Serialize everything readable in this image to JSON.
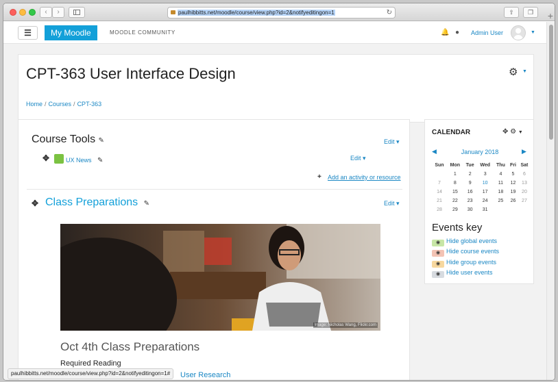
{
  "browser": {
    "url": "paulhibbitts.net/moodle/course/view.php?id=2&notifyeditingon=1",
    "status_url": "paulhibbitts.net/moodle/course/view.php?id=2&notifyeditingon=1#"
  },
  "navbar": {
    "brand": "My Moodle",
    "community": "MOODLE COMMUNITY",
    "user_name": "Admin User"
  },
  "header": {
    "title": "CPT-363 User Interface Design",
    "breadcrumb": [
      "Home",
      "Courses",
      "CPT-363"
    ]
  },
  "course_tools": {
    "title": "Course Tools",
    "edit_label": "Edit",
    "item_label": "UX News",
    "item_edit_label": "Edit",
    "add_activity": "Add an activity or resource"
  },
  "class_prep": {
    "title": "Class Preparations",
    "edit_label": "Edit",
    "image_caption": "Image: Nicholas Wang, Flickr.com",
    "heading": "Oct 4th Class Preparations",
    "required_reading": "Required Reading",
    "link_partial": "User Research"
  },
  "calendar": {
    "heading": "CALENDAR",
    "month": "January 2018",
    "weekdays": [
      "Sun",
      "Mon",
      "Tue",
      "Wed",
      "Thu",
      "Fri",
      "Sat"
    ],
    "weeks": [
      [
        "",
        "1",
        "2",
        "3",
        "4",
        "5",
        "6"
      ],
      [
        "7",
        "8",
        "9",
        "10",
        "11",
        "12",
        "13"
      ],
      [
        "14",
        "15",
        "16",
        "17",
        "18",
        "19",
        "20"
      ],
      [
        "21",
        "22",
        "23",
        "24",
        "25",
        "26",
        "27"
      ],
      [
        "28",
        "29",
        "30",
        "31",
        "",
        "",
        ""
      ]
    ],
    "today": "10"
  },
  "events_key": {
    "heading": "Events key",
    "items": [
      {
        "label": "Hide global events",
        "color": "#c7e6a6"
      },
      {
        "label": "Hide course events",
        "color": "#f3c3b4"
      },
      {
        "label": "Hide group events",
        "color": "#f7d89f"
      },
      {
        "label": "Hide user events",
        "color": "#d7dbe0"
      }
    ]
  },
  "colors": {
    "brand": "#13a0d9",
    "link": "#1a87c4"
  }
}
